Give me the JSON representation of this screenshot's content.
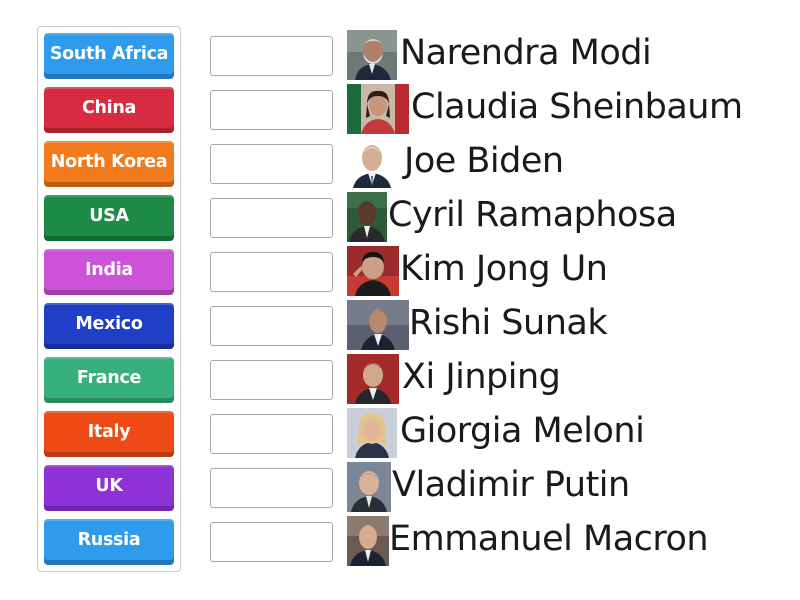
{
  "tiles": [
    {
      "label": "South Africa",
      "color": "#2e9bec"
    },
    {
      "label": "China",
      "color": "#d92b3f"
    },
    {
      "label": "North Korea",
      "color": "#f07a1c"
    },
    {
      "label": "USA",
      "color": "#1d8a45"
    },
    {
      "label": "India",
      "color": "#cc52d8"
    },
    {
      "label": "Mexico",
      "color": "#1f3fc6"
    },
    {
      "label": "France",
      "color": "#35b07a"
    },
    {
      "label": "Italy",
      "color": "#ee4a16"
    },
    {
      "label": "UK",
      "color": "#8e32d8"
    },
    {
      "label": "Russia",
      "color": "#2e9bec"
    }
  ],
  "targets": [
    {
      "name": "Narendra Modi"
    },
    {
      "name": "Claudia Sheinbaum"
    },
    {
      "name": "Joe Biden"
    },
    {
      "name": "Cyril Ramaphosa"
    },
    {
      "name": "Kim Jong Un"
    },
    {
      "name": "Rishi Sunak"
    },
    {
      "name": "Xi Jinping"
    },
    {
      "name": "Giorgia Meloni"
    },
    {
      "name": "Vladimir Putin"
    },
    {
      "name": "Emmanuel Macron"
    }
  ]
}
